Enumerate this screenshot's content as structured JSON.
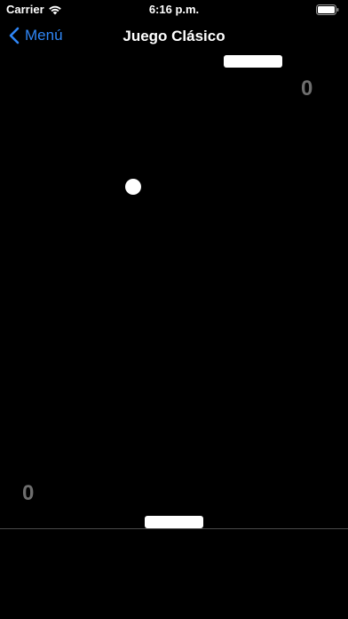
{
  "status_bar": {
    "carrier": "Carrier",
    "time": "6:16 p.m."
  },
  "nav": {
    "back_label": "Menú",
    "title": "Juego Clásico",
    "accent_color": "#2f86f6"
  },
  "game": {
    "score_top": "0",
    "score_bottom": "0",
    "score_color": "#6e6e6e",
    "background_color": "#000000"
  }
}
